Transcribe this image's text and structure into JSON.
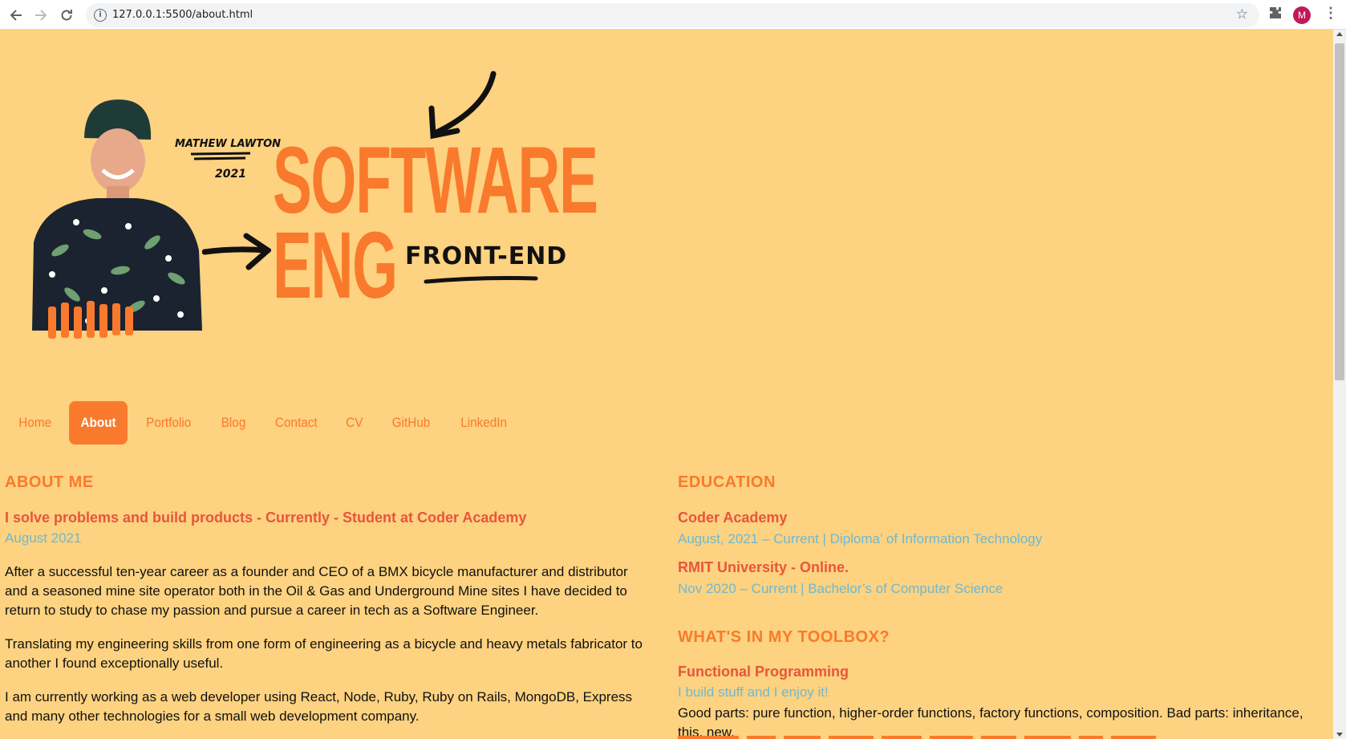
{
  "browser": {
    "url": "127.0.0.1:5500/about.html",
    "avatar_letter": "M"
  },
  "hero": {
    "signature_name": "MATHEW LAWTON",
    "signature_year": "2021",
    "title_line1": "SOFTWARE",
    "title_line2": "ENG",
    "tagline": "FRONT-END"
  },
  "nav": {
    "items": [
      {
        "label": "Home"
      },
      {
        "label": "About"
      },
      {
        "label": "Portfolio"
      },
      {
        "label": "Blog"
      },
      {
        "label": "Contact"
      },
      {
        "label": "CV"
      },
      {
        "label": "GitHub"
      },
      {
        "label": "LinkedIn"
      }
    ],
    "active": "About"
  },
  "about": {
    "heading": "ABOUT ME",
    "role": "I solve problems and build products - Currently - Student at Coder Academy",
    "date": "August 2021",
    "paragraphs": [
      "After a successful ten-year career as a founder and CEO of a BMX bicycle manufacturer and distributor and a seasoned mine site operator both in the Oil & Gas and Underground Mine sites I have decided to return to study to chase my passion and pursue a career in tech as a Software Engineer.",
      "Translating my engineering skills from one form of engineering as a bicycle and heavy metals fabricator to another I found exceptionally useful.",
      "I am currently working as a web developer using React, Node, Ruby, Ruby on Rails, MongoDB, Express and many other technologies for a small web development company."
    ]
  },
  "education": {
    "heading": "EDUCATION",
    "entries": [
      {
        "school": "Coder Academy",
        "detail": "August, 2021 – Current  |  Diploma’ of Information Technology"
      },
      {
        "school": "RMIT University - Online.",
        "detail": "Nov 2020 – Current  |  Bachelor’s of Computer Science"
      }
    ]
  },
  "toolbox": {
    "heading": "WHAT'S IN MY TOOLBOX?",
    "title": "Functional Programming",
    "subtitle": "I build stuff and I enjoy it!",
    "text": "Good parts: pure function, higher-order functions, factory functions, composition. Bad parts: inheritance, this, new."
  },
  "colors": {
    "background": "#fdd280",
    "accent": "#f97a2c",
    "heading_red": "#e8553c",
    "subtle_blue": "#6fb9d0"
  }
}
